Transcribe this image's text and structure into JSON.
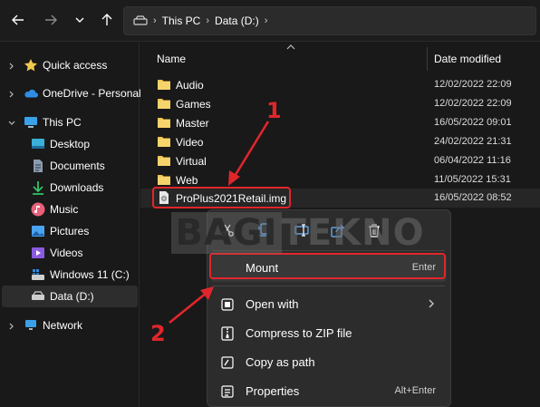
{
  "address": {
    "crumbs": [
      "This PC",
      "Data (D:)"
    ]
  },
  "sidebar": {
    "items": [
      {
        "label": "Quick access"
      },
      {
        "label": "OneDrive - Personal"
      },
      {
        "label": "This PC"
      },
      {
        "label": "Desktop"
      },
      {
        "label": "Documents"
      },
      {
        "label": "Downloads"
      },
      {
        "label": "Music"
      },
      {
        "label": "Pictures"
      },
      {
        "label": "Videos"
      },
      {
        "label": "Windows 11 (C:)"
      },
      {
        "label": "Data (D:)"
      },
      {
        "label": "Network"
      }
    ]
  },
  "columns": {
    "name": "Name",
    "date": "Date modified"
  },
  "files": [
    {
      "name": "Audio",
      "date": "12/02/2022 22:09"
    },
    {
      "name": "Games",
      "date": "12/02/2022 22:09"
    },
    {
      "name": "Master",
      "date": "16/05/2022 09:01"
    },
    {
      "name": "Video",
      "date": "24/02/2022 21:31"
    },
    {
      "name": "Virtual",
      "date": "06/04/2022 11:16"
    },
    {
      "name": "Web",
      "date": "11/05/2022 15:31"
    },
    {
      "name": "ProPlus2021Retail.img",
      "date": "16/05/2022 08:52"
    }
  ],
  "context_menu": {
    "items": [
      {
        "label": "Mount",
        "shortcut": "Enter"
      },
      {
        "label": "Open with"
      },
      {
        "label": "Compress to ZIP file"
      },
      {
        "label": "Copy as path"
      },
      {
        "label": "Properties",
        "shortcut": "Alt+Enter"
      }
    ]
  },
  "watermark": {
    "part1": "BAGI",
    "part2": "TEKNO"
  },
  "annotations": {
    "one": "1",
    "two": "2"
  },
  "colors": {
    "accent_red": "#e0262b",
    "folder": "#f4c54a"
  }
}
